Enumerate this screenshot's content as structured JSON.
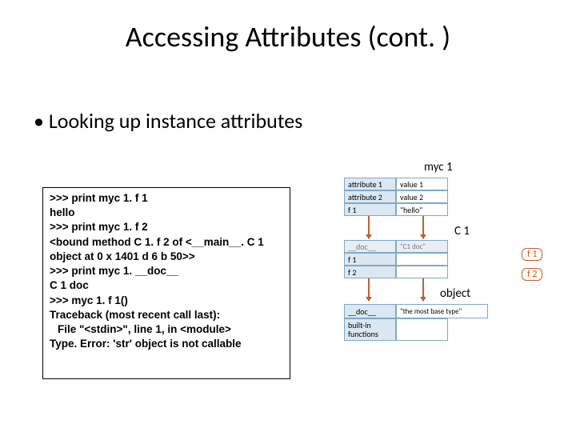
{
  "title": "Accessing Attributes (cont. )",
  "bullet": "Looking up instance attributes",
  "code": {
    "l1": ">>> print myc 1. f 1",
    "l2": "hello",
    "l3": ">>> print myc 1. f 2",
    "l4": "<bound method C 1. f 2 of <__main__. C 1 object at 0 x 1401 d 6 b 50>>",
    "l5": ">>> print myc 1. __doc__",
    "l6": "C 1 doc",
    "l7": ">>> myc 1. f 1()",
    "l8": "Traceback (most recent call last):",
    "l9": "File \"<stdin>\", line 1, in <module>",
    "l10": "Type. Error: 'str' object is not callable"
  },
  "diagram": {
    "myc1_label": "myc 1",
    "myc1": {
      "a1k": "attribute 1",
      "a1v": "value 1",
      "a2k": "attribute 2",
      "a2v": "value 2",
      "a3k": "f 1",
      "a3v": "\"hello\""
    },
    "c1_label": "C 1",
    "c1": {
      "r1k": "__doc__",
      "r1v": "\"C1 doc\"",
      "r2k": "f 1",
      "r3k": "f 2"
    },
    "f1_pill": "f 1",
    "f2_pill": "f 2",
    "object_label": "object",
    "object": {
      "r1k": "__doc__",
      "r1v": "\"the most base type\"",
      "r2k": "built-in\nfunctions"
    }
  }
}
